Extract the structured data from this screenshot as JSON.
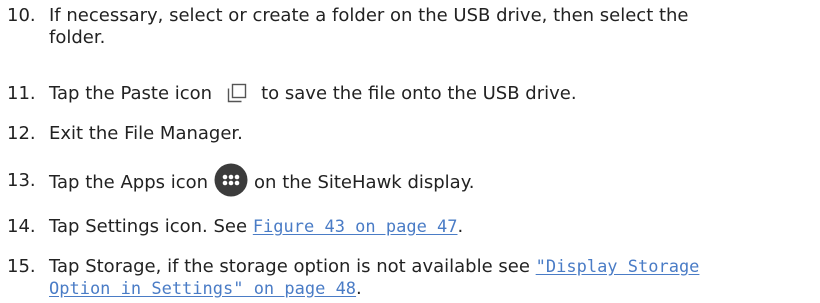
{
  "steps": [
    {
      "number": "10.",
      "line1": "If necessary, select or create a folder on the USB drive, then select the",
      "line2": "folder."
    },
    {
      "number": "11.",
      "before": "Tap the Paste icon",
      "icon": "paste-icon",
      "after": "to save the file onto the USB drive."
    },
    {
      "number": "12.",
      "text": "Exit the File Manager."
    },
    {
      "number": "13.",
      "before": "Tap the Apps icon",
      "icon": "apps-icon",
      "after": "on the SiteHawk display."
    },
    {
      "number": "14.",
      "before": "Tap Settings icon. See ",
      "link": "Figure 43 on page 47",
      "after": "."
    },
    {
      "number": "15.",
      "before": "Tap Storage, if the storage option is not available see ",
      "link_line1": "\"Display Storage",
      "link_line2": "Option in Settings\" on page 48",
      "after": "."
    }
  ],
  "colors": {
    "text": "#222222",
    "link": "#4a7cc6",
    "apps_icon_bg": "#3c3c3c"
  }
}
